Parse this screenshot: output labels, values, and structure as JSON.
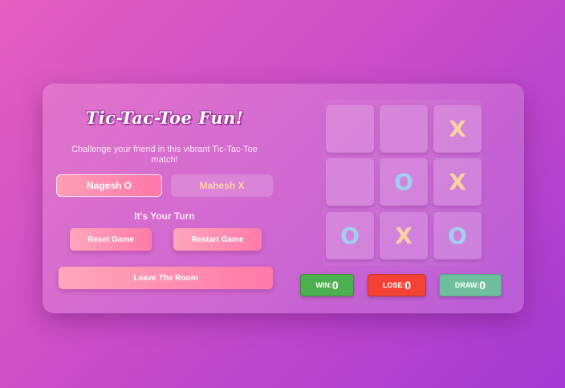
{
  "game": {
    "title": "Tic-Tac-Toe Fun!",
    "subtitle": "Challenge your friend in this vibrant Tic-Tac-Toe match!",
    "players": [
      {
        "label": "Nagesh O",
        "active": true
      },
      {
        "label": "Mahesh X",
        "active": false
      }
    ],
    "turn_text": "It's Your Turn",
    "buttons": {
      "reset": "Reset Game",
      "restart": "Restart Game",
      "leave": "Leave The Room"
    }
  },
  "board": [
    [
      "",
      "",
      "X"
    ],
    [
      "",
      "O",
      "X"
    ],
    [
      "O",
      "X",
      "O"
    ]
  ],
  "scores": {
    "win_label": "WIN:",
    "win": "0",
    "lose_label": "LOSE:",
    "lose": "0",
    "draw_label": "DRAW:",
    "draw": "0"
  },
  "colors": {
    "x_mark": "#fdd2a3",
    "o_mark": "#9fd0ee",
    "win": "#4caf50",
    "lose": "#f44336",
    "draw": "#6fbf9f"
  }
}
